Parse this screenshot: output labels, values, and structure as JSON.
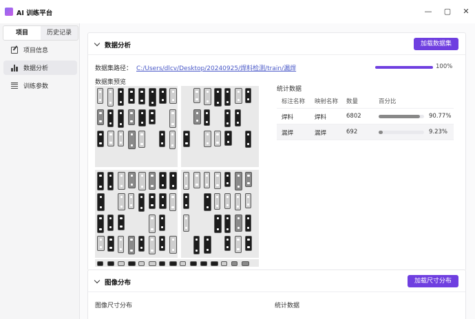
{
  "app": {
    "title": "AI 训练平台"
  },
  "window": {
    "min_glyph": "—",
    "max_glyph": "▢",
    "close_glyph": "✕"
  },
  "sidebar": {
    "tabs": [
      {
        "label": "项目"
      },
      {
        "label": "历史记录"
      }
    ],
    "items": [
      {
        "label": "项目信息",
        "icon": "edit-icon"
      },
      {
        "label": "数据分析",
        "icon": "bar-chart-icon"
      },
      {
        "label": "训练参数",
        "icon": "sliders-icon"
      }
    ]
  },
  "analysis": {
    "title": "数据分析",
    "load_button": "加载数据集",
    "path_label": "数据集路径：",
    "path_value": "C:/Users/dlcv/Desktop/20240925/焊料检测/train/漏焊",
    "progress": {
      "value": 1.0,
      "text": "100%"
    },
    "preview_label": "数据集预览",
    "stats_label": "统计数据",
    "columns": [
      "标注名称",
      "映射名称",
      "数量",
      "百分比"
    ],
    "rows": [
      {
        "label": "焊料",
        "mapped": "焊料",
        "count": "6802",
        "fraction": 0.9077,
        "percent": "90.77%"
      },
      {
        "label": "漏焊",
        "mapped": "漏焊",
        "count": "692",
        "fraction": 0.0923,
        "percent": "9.23%"
      }
    ]
  },
  "distribution": {
    "title": "图像分布",
    "load_button": "加载尺寸分布",
    "size_label": "图像尺寸分布",
    "stats_label": "统计数据"
  },
  "colors": {
    "accent": "#6f3fe0",
    "link": "#4a59c8"
  }
}
